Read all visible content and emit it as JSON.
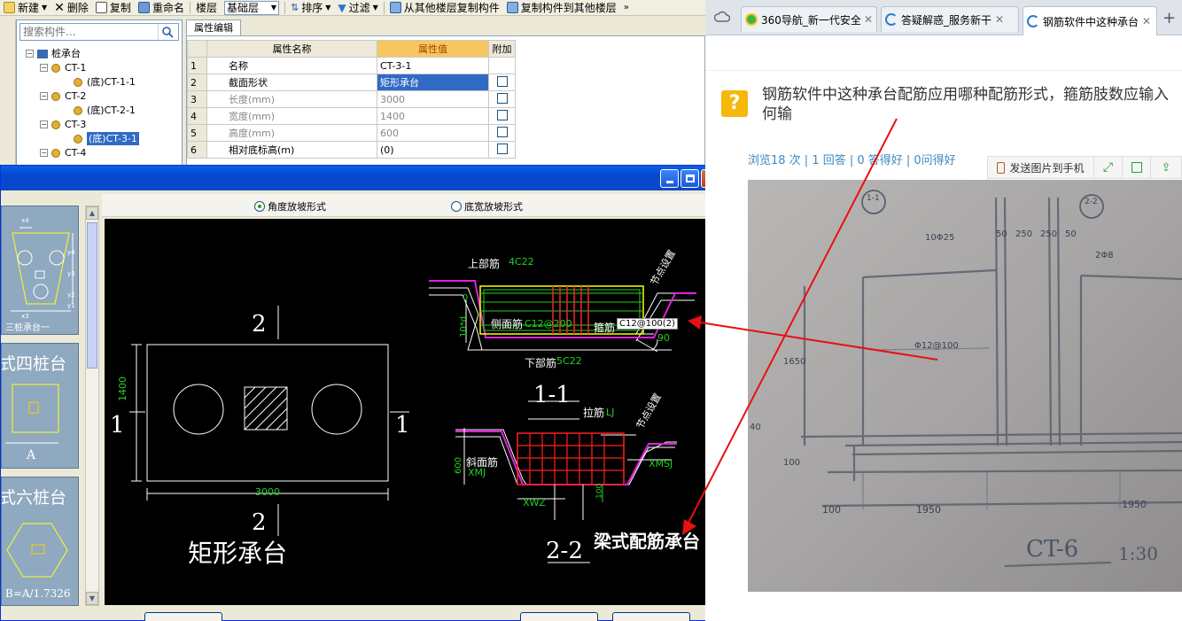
{
  "toolbar": {
    "items": [
      "新建",
      "删除",
      "复制",
      "重命名"
    ],
    "floor_label": "楼层",
    "floor_value": "基础层",
    "sort_label": "排序",
    "filter_label": "过滤",
    "copy_from_label": "从其他楼层复制构件",
    "copy_to_label": "复制构件到其他楼层"
  },
  "tree": {
    "search_placeholder": "搜索构件...",
    "root": "桩承台",
    "nodes": [
      "CT-1",
      "(底)CT-1-1",
      "CT-2",
      "(底)CT-2-1",
      "CT-3",
      "(底)CT-3-1",
      "CT-4"
    ]
  },
  "properties": {
    "tab": "属性编辑",
    "headers": [
      "属性名称",
      "属性值",
      "附加"
    ],
    "rows": [
      {
        "idx": "1",
        "name": "名称",
        "value": "CT-3-1"
      },
      {
        "idx": "2",
        "name": "截面形状",
        "value": "矩形承台"
      },
      {
        "idx": "3",
        "name": "长度(mm)",
        "value": "3000"
      },
      {
        "idx": "4",
        "name": "宽度(mm)",
        "value": "1400"
      },
      {
        "idx": "5",
        "name": "高度(mm)",
        "value": "600"
      },
      {
        "idx": "6",
        "name": "相对底标高(m)",
        "value": "(0)"
      }
    ]
  },
  "dialog": {
    "radio_angle": "角度放坡形式",
    "radio_width": "底宽放坡形式",
    "thumbs": {
      "three_pile_caption": "三桩承台一",
      "four_pile_title": "式四桩台",
      "four_pile_label": "A",
      "six_pile_title": "式六桩台",
      "six_pile_formula": "B=A/1.7326",
      "tri_dims": [
        "x4",
        "y4",
        "y3",
        "x3",
        "y2",
        "y1"
      ]
    },
    "drawing": {
      "plan": {
        "title": "矩形承台",
        "section_2_top": "2",
        "section_2_bottom": "2",
        "section_1_left": "1",
        "section_1_right": "1",
        "width_dim": "3000",
        "height_dim": "1400"
      },
      "section_1": {
        "title": "1-1",
        "top_bar_label": "上部筋",
        "top_bar_value": "4C22",
        "side_bar_label": "侧面筋",
        "side_bar_value": "C12@200",
        "stirrup_label": "箍筋",
        "stirrup_value": "C12@100(2)",
        "bottom_bar_label": "下部筋",
        "bottom_bar_value": "5C22",
        "node_note": "节点设置",
        "angle": "90",
        "zero_mark": "0",
        "left_dim": "10*d"
      },
      "section_2": {
        "title": "2-2",
        "tie_label": "拉筋",
        "tie_value": "LJ",
        "slope_label": "斜面筋",
        "slope_value": "XMJ",
        "side_value": "XMSJ",
        "bottom_value": "XWZ",
        "height_dim": "600",
        "node_note": "节点设置",
        "inner_dim": "100"
      },
      "annotation": "梁式配筋承台"
    }
  },
  "browser": {
    "tabs": [
      {
        "title": "360导航_新一代安全"
      },
      {
        "title": "答疑解惑_服务新干"
      },
      {
        "title": "钢筋软件中这种承台"
      }
    ],
    "question": "钢筋软件中这种承台配筋应用哪种配筋形式，箍筋肢数应输入何输",
    "stats": "浏览18 次 | 1 回答 | 0 答得好 | 0问得好",
    "send_to_phone": "发送图片到手机",
    "photo_labels": {
      "dim_10": "10Φ25",
      "dim_50a": "50",
      "dim_250a": "250",
      "dim_250b": "250",
      "dim_50b": "50",
      "dim_2phi": "2Φ8",
      "stirrup": "Φ12@100",
      "height": "1650",
      "dim_40": "40",
      "dim_100v": "100",
      "dim_100h": "100",
      "dim_1950a": "1950",
      "dim_1950b": "1950",
      "sec_11": "1-1",
      "sec_22": "2-2",
      "name": "CT-6",
      "scale": "1:30"
    }
  },
  "colors": {
    "cad_green": "#22d022",
    "cad_red": "#ff2020",
    "cad_yellow": "#ffff00",
    "cad_magenta": "#e020e0",
    "arrow_red": "#e81010",
    "link_blue": "#3f88bf"
  }
}
